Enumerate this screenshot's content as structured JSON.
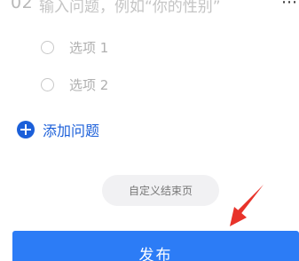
{
  "question": {
    "number": "02",
    "placeholder": "输入问题，例如“你的性别”",
    "more": "⋯",
    "options": [
      {
        "label": "选项 1"
      },
      {
        "label": "选项 2"
      }
    ]
  },
  "actions": {
    "add_question": "添加问题",
    "custom_end_page": "自定义结束页",
    "publish": "发布"
  },
  "colors": {
    "accent": "#1b5fd9",
    "publish_bg": "#2c7cf6",
    "arrow": "#e8332a"
  }
}
